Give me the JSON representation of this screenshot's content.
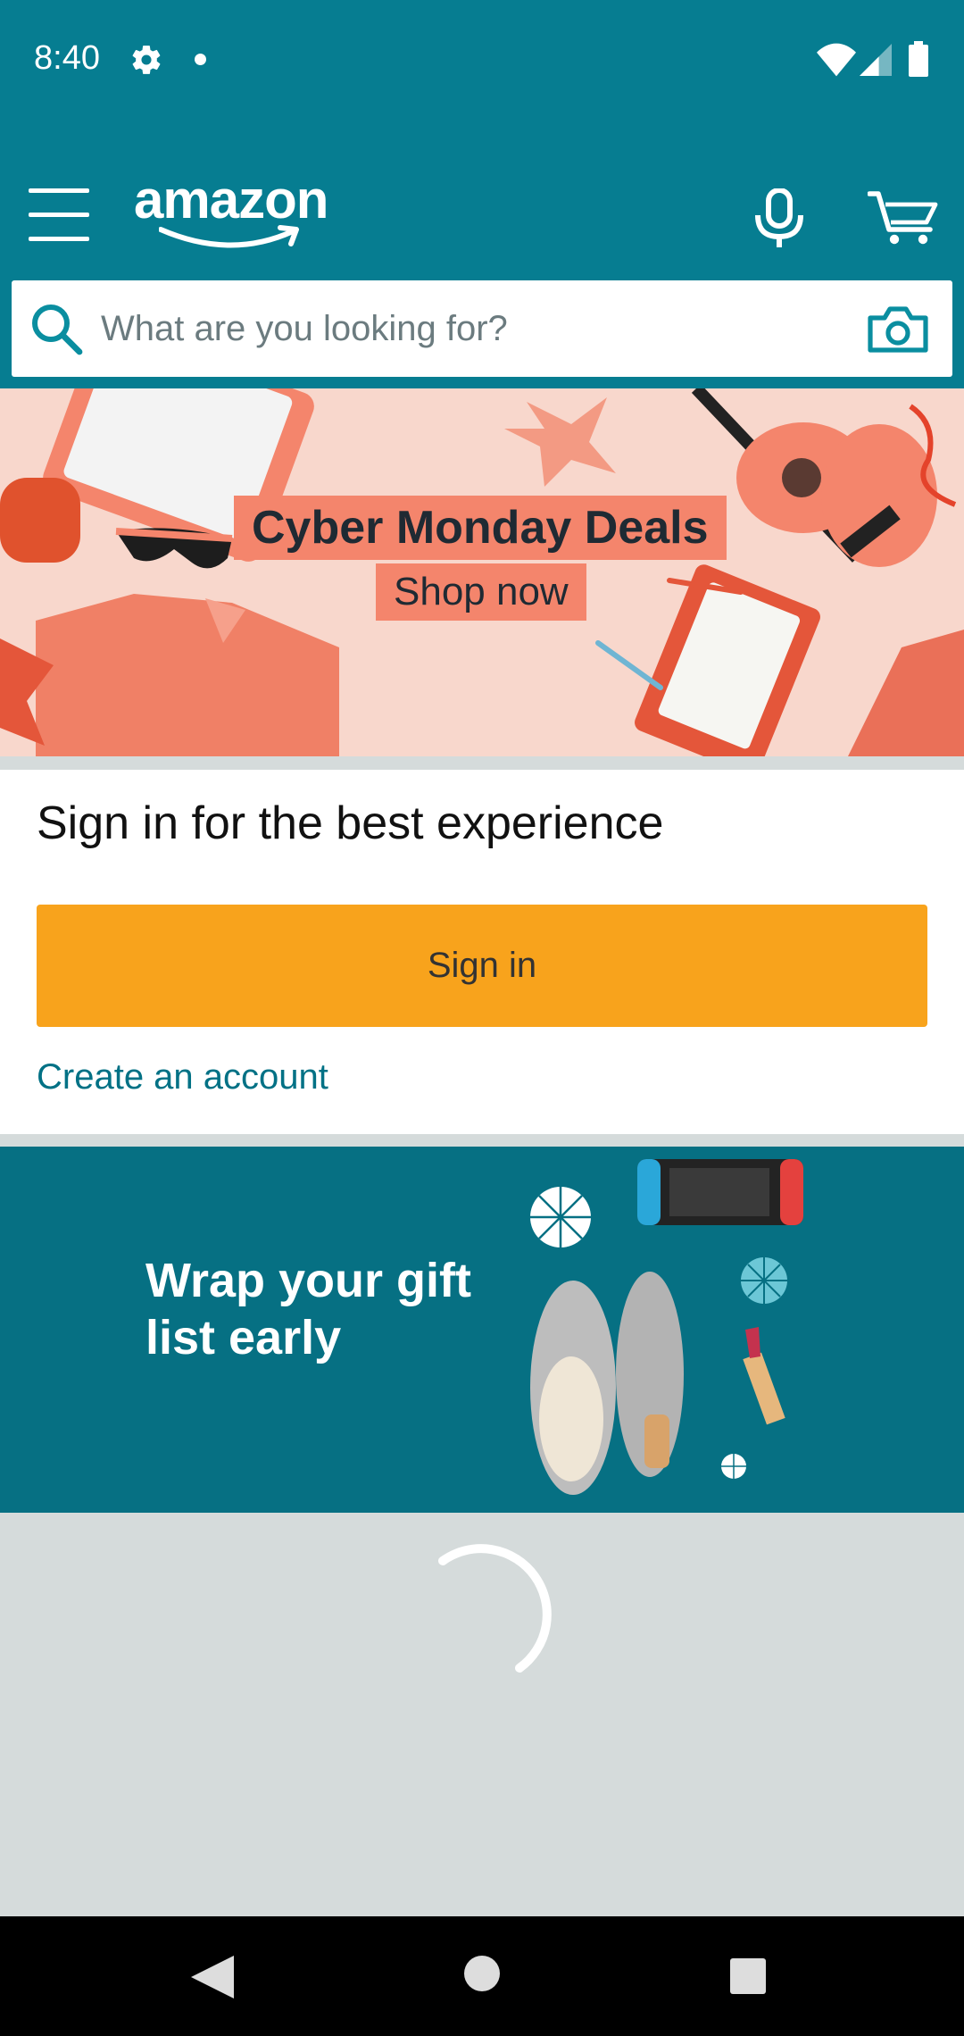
{
  "status_bar": {
    "time": "8:40",
    "icons": [
      "gear-icon",
      "notification-dot-icon",
      "wifi-icon",
      "signal-icon",
      "battery-icon"
    ]
  },
  "header": {
    "logo_text": "amazon",
    "icons": [
      "menu-icon",
      "microphone-icon",
      "cart-icon"
    ],
    "brand_color": "#067d91"
  },
  "search": {
    "placeholder": "What are you looking for?",
    "value": "",
    "icons": [
      "search-icon",
      "camera-icon"
    ]
  },
  "hero_banner": {
    "title": "Cyber Monday Deals",
    "subtitle": "Shop now",
    "accent_color": "#f4856c"
  },
  "signin_card": {
    "heading": "Sign in for the best experience",
    "button_label": "Sign in",
    "create_account_label": "Create an account",
    "button_color": "#f8a31c",
    "link_color": "#007185"
  },
  "gift_banner": {
    "text": "Wrap your gift list early",
    "background_color": "#067083"
  },
  "loading": {
    "icon": "loading-spinner-icon"
  },
  "nav_bar": {
    "icons": [
      "back-icon",
      "home-icon",
      "recents-icon"
    ]
  }
}
